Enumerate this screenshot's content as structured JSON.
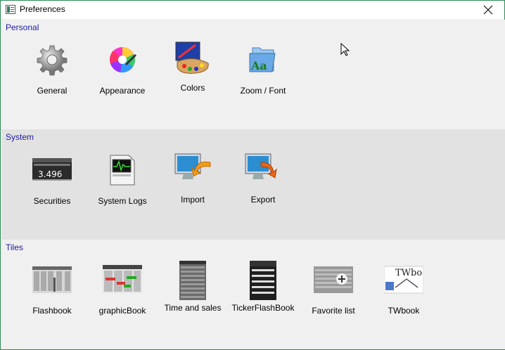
{
  "window": {
    "title": "Preferences"
  },
  "sections": {
    "personal": {
      "title": "Personal",
      "items": [
        {
          "label": "General",
          "icon": "gear-icon"
        },
        {
          "label": "Appearance",
          "icon": "palette-wheel-icon"
        },
        {
          "label": "Colors",
          "icon": "paint-palette-icon"
        },
        {
          "label": "Zoom / Font",
          "icon": "font-folder-icon"
        }
      ]
    },
    "system": {
      "title": "System",
      "items": [
        {
          "label": "Securities",
          "icon": "ticker-display-icon",
          "ticker_value": "3.496"
        },
        {
          "label": "System Logs",
          "icon": "log-monitor-icon"
        },
        {
          "label": "Import",
          "icon": "monitor-import-icon"
        },
        {
          "label": "Export",
          "icon": "monitor-export-icon"
        }
      ]
    },
    "tiles": {
      "title": "Tiles",
      "items": [
        {
          "label": "Flashbook",
          "icon": "flashbook-icon"
        },
        {
          "label": "graphicBook",
          "icon": "graphicbook-icon"
        },
        {
          "label": "Time and sales",
          "icon": "time-sales-icon"
        },
        {
          "label": "TickerFlashBook",
          "icon": "ticker-flashbook-icon"
        },
        {
          "label": "Favorite list",
          "icon": "favorite-list-icon"
        },
        {
          "label": "TWbook",
          "icon": "twbook-icon",
          "logo_text": "TWbo"
        }
      ]
    }
  },
  "colors": {
    "section_title": "#1a1aa6",
    "window_border": "#2e8b57",
    "system_bg": "#e2e2e2",
    "default_bg": "#f0f0f0"
  }
}
